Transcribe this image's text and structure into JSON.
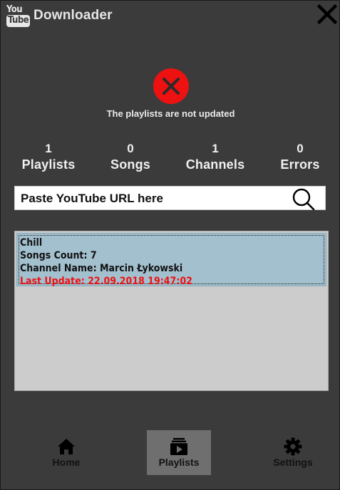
{
  "app": {
    "logo_top": "You",
    "logo_bottom": "Tube",
    "title": "Downloader",
    "close_icon": "close-icon"
  },
  "status": {
    "icon": "error-x-icon",
    "icon_color": "#ee1111",
    "text": "The playlists are not updated"
  },
  "stats": [
    {
      "value": "1",
      "label": "Playlists"
    },
    {
      "value": "0",
      "label": "Songs"
    },
    {
      "value": "1",
      "label": "Channels"
    },
    {
      "value": "0",
      "label": "Errors"
    }
  ],
  "search": {
    "placeholder": "Paste YouTube URL here",
    "value": "",
    "icon": "search-icon"
  },
  "playlists": [
    {
      "name": "Chill",
      "songs_count": "Songs Count: 7",
      "channel_name": "Channel Name: Marcin Łykowski",
      "last_update": "Last Update: 22.09.2018 19:47:02",
      "selected_bg": "#a3c0cf",
      "update_color": "#ee1111"
    }
  ],
  "nav": {
    "items": [
      {
        "label": "Home",
        "icon": "home-icon"
      },
      {
        "label": "Playlists",
        "icon": "playlists-icon",
        "active": true
      },
      {
        "label": "Settings",
        "icon": "gear-icon"
      }
    ]
  },
  "colors": {
    "background": "#3b3b3b",
    "active_nav": "#6f6f6f",
    "list_bg": "#cccccc"
  }
}
